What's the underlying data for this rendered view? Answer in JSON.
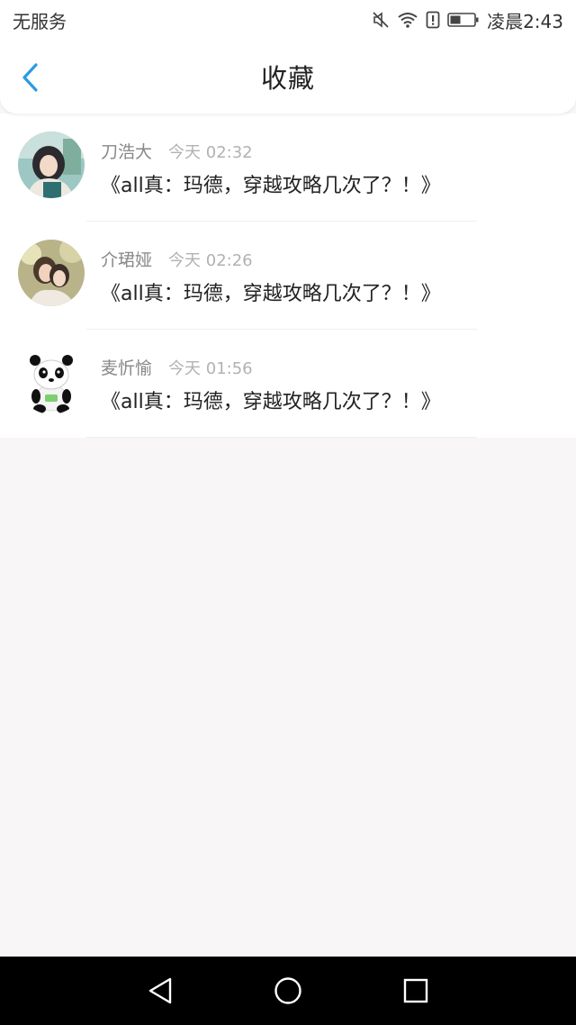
{
  "status_bar": {
    "carrier": "无服务",
    "time": "凌晨2:43",
    "icons": [
      "mute-icon",
      "wifi-icon",
      "alert-icon",
      "battery-icon"
    ]
  },
  "header": {
    "title": "收藏",
    "back_icon": "chevron-left-icon",
    "accent": "#2a9be6"
  },
  "favorites": [
    {
      "name": "刀浩大",
      "time": "今天 02:32",
      "text": "《all真：玛德，穿越攻略几次了？！》",
      "avatar": "photo-avatar"
    },
    {
      "name": "介珺娅",
      "time": "今天 02:26",
      "text": "《all真：玛德，穿越攻略几次了？！》",
      "avatar": "couple-photo-avatar"
    },
    {
      "name": "麦忻愉",
      "time": "今天 01:56",
      "text": "《all真：玛德，穿越攻略几次了？！》",
      "avatar": "panda-avatar"
    }
  ],
  "nav_bar": {
    "icons": [
      "back-triangle-icon",
      "home-circle-icon",
      "recents-square-icon"
    ]
  }
}
